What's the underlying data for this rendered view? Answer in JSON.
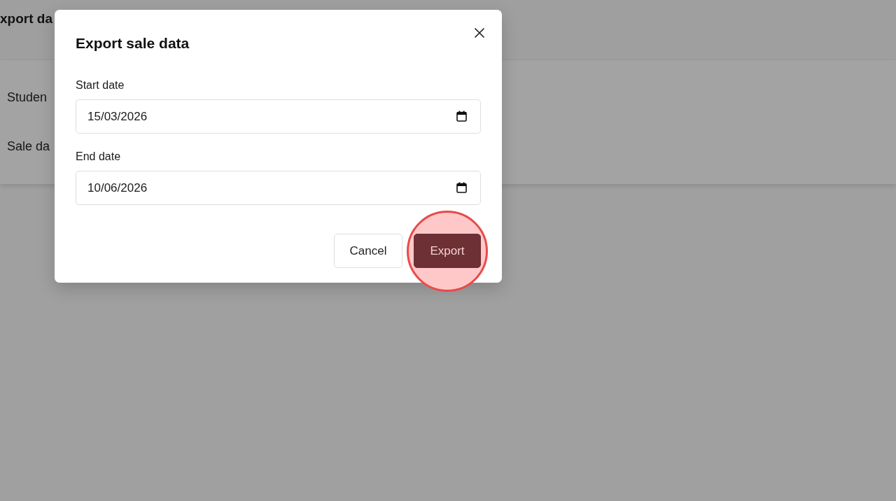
{
  "background_page": {
    "title": "xport da",
    "fields": [
      {
        "label": "Studen"
      },
      {
        "label": "Sale da"
      }
    ]
  },
  "dialog": {
    "title": "Export sale data",
    "fields": [
      {
        "label": "Start date",
        "value": "15/03/2026"
      },
      {
        "label": "End date",
        "value": "10/06/2026"
      }
    ],
    "buttons": [
      {
        "label": "Cancel",
        "kind": "secondary",
        "highlighted": false
      },
      {
        "label": "Export",
        "kind": "primary",
        "highlighted": true
      }
    ]
  }
}
